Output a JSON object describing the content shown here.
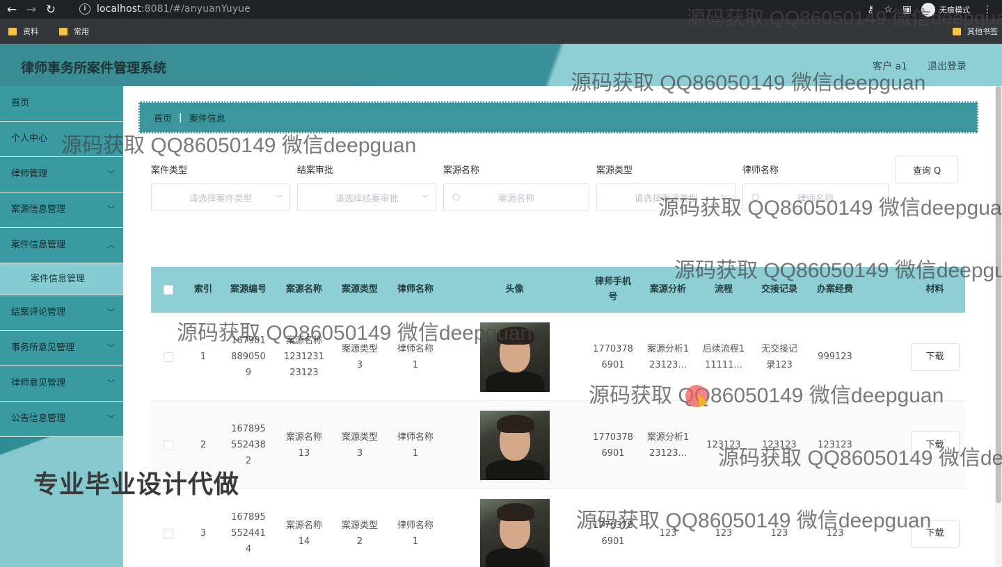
{
  "browser": {
    "url_host": "localhost",
    "url_rest": ":8081/#/anyuanYuyue",
    "incognito_label": "无痕模式",
    "bookmarks": [
      "资料",
      "常用"
    ],
    "other_bookmarks": "其他书签"
  },
  "header": {
    "title": "律师事务所案件管理系统",
    "user": "客户 a1",
    "logout": "退出登录"
  },
  "sidebar": {
    "items": [
      {
        "label": "首页"
      },
      {
        "label": "个人中心"
      },
      {
        "label": "律师管理"
      },
      {
        "label": "案源信息管理"
      },
      {
        "label": "案件信息管理"
      },
      {
        "label": "案件信息管理"
      },
      {
        "label": "结案评论管理"
      },
      {
        "label": "事务所意见管理"
      },
      {
        "label": "律师意见管理"
      },
      {
        "label": "公告信息管理"
      }
    ],
    "promo": "专业毕业设计代做"
  },
  "breadcrumb": {
    "home": "首页",
    "sep": "|",
    "current": "案件信息"
  },
  "filters": [
    {
      "label": "案件类型",
      "placeholder": "请选择案件类型"
    },
    {
      "label": "结案审批",
      "placeholder": "请选择结案审批"
    },
    {
      "label": "案源名称",
      "placeholder": "案源名称"
    },
    {
      "label": "案源类型",
      "placeholder": "请选择案源类型"
    },
    {
      "label": "律师名称",
      "placeholder": "律师名称"
    }
  ],
  "query_button": "查询 Q",
  "table": {
    "headers": [
      "索引",
      "案源编号",
      "案源名称",
      "案源类型",
      "律师名称",
      "头像",
      "律师手机号",
      "案源分析",
      "流程",
      "交接记录",
      "办案经费",
      "材料"
    ],
    "rows": [
      {
        "index": "1",
        "code": "1679018890509",
        "name": "案源名称123123123123",
        "type": "案源类型3",
        "lawyer": "律师名称1",
        "phone": "17703786901",
        "analysis": "案源分析123123...",
        "flow": "后续流程111111...",
        "handover": "无交接记录123",
        "fee": "999123",
        "material": "下载"
      },
      {
        "index": "2",
        "code": "1678955524382",
        "name": "案源名称13",
        "type": "案源类型3",
        "lawyer": "律师名称1",
        "phone": "17703786901",
        "analysis": "案源分析123123...",
        "flow": "123123",
        "handover": "123123",
        "fee": "123123",
        "material": "下载"
      },
      {
        "index": "3",
        "code": "1678955524414",
        "name": "案源名称14",
        "type": "案源类型2",
        "lawyer": "律师名称1",
        "phone": "17703786901",
        "analysis": "123",
        "flow": "123",
        "handover": "123",
        "fee": "123",
        "material": "下载"
      }
    ]
  },
  "watermark": "源码获取 QQ86050149 微信deepguan",
  "colors": {
    "teal": "#3a9aa1",
    "light_teal": "#8ecfd6"
  }
}
